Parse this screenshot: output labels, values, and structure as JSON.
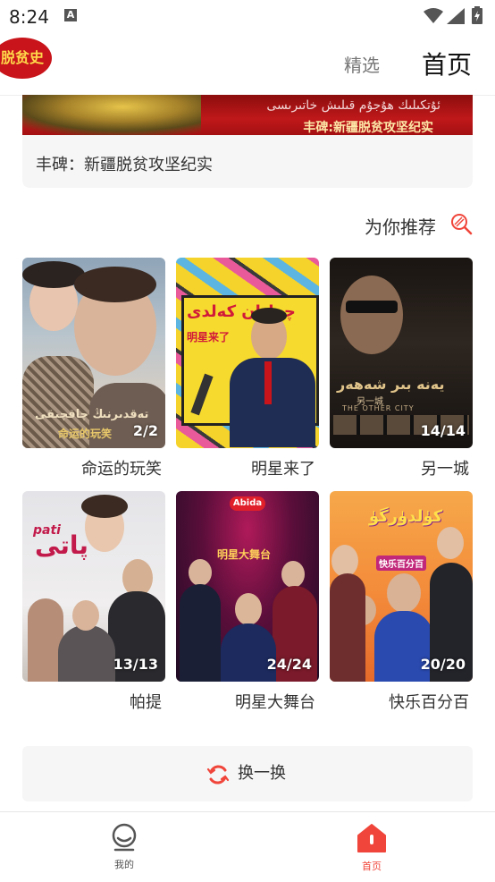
{
  "status_bar": {
    "time": "8:24",
    "notif_letter": "A"
  },
  "header": {
    "logo_text": "脱贫史",
    "tab_selected_label": "精选",
    "tab_home_label": "首页"
  },
  "banner": {
    "uyghur_text": "ئۇتكىلىك ھۇجۇم قىلىش خاتىرىسى",
    "chinese_text": "丰碑:新疆脱贫攻坚纪实",
    "title": "丰碑：新疆脱贫攻坚纪实"
  },
  "recommend": {
    "heading": "为你推荐",
    "items": [
      {
        "title": "命运的玩笑",
        "count": "2/2",
        "overlay_uy": "تەقدىرنىڭ چاقچىقى",
        "overlay_cn": "命运的玩笑"
      },
      {
        "title": "明星来了",
        "count": "",
        "overlay_uy": "چولپان كەلدى",
        "overlay_cn": "明星来了"
      },
      {
        "title": "另一城",
        "count": "14/14",
        "overlay_uy": "يەنە بىر شەھەر",
        "overlay_cn": "另一城",
        "overlay_en": "THE OTHER CITY"
      },
      {
        "title": "帕提",
        "count": "13/13",
        "overlay_uy": "پاتى",
        "overlay_latin": "pati"
      },
      {
        "title": "明星大舞台",
        "count": "24/24",
        "overlay_brand": "Abida",
        "overlay_cn": "明星大舞台"
      },
      {
        "title": "快乐百分百",
        "count": "20/20",
        "overlay_uy": "كۈلدۈرگۈ",
        "overlay_cn": "快乐百分百"
      }
    ]
  },
  "refresh_label": "换一换",
  "bottom_nav": {
    "mine_label": "我的",
    "home_label": "首页"
  },
  "colors": {
    "accent": "#f0453a",
    "brand_red": "#c8141a",
    "inactive": "#777777"
  },
  "icons": {
    "status": [
      "a-notification-icon",
      "wifi-icon",
      "signal-icon",
      "battery-icon"
    ],
    "recommend": "recommend-icon",
    "refresh": "refresh-icon",
    "nav": [
      "mine-icon",
      "home-icon"
    ]
  }
}
